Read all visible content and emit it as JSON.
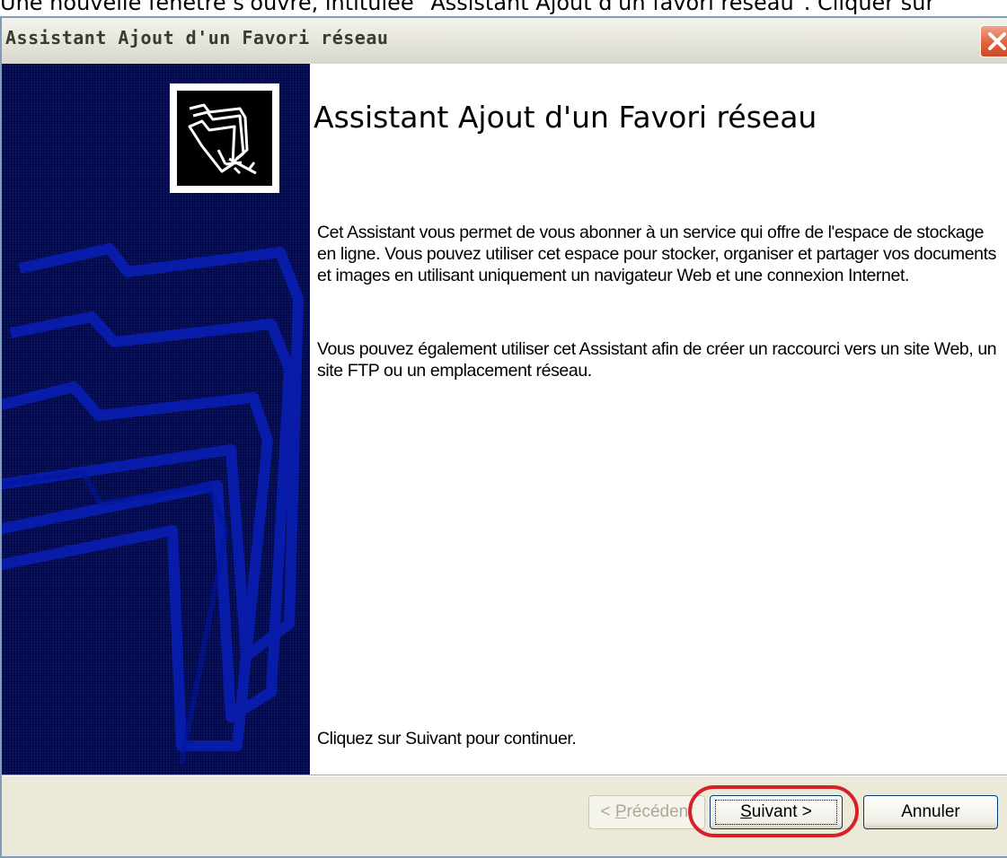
{
  "caption": "Une nouvelle fenêtre s'ouvre, intitulée \"Assistant Ajout d'un favori réseau\". Cliquer sur",
  "window": {
    "title": "Assistant Ajout d'un Favori réseau"
  },
  "content": {
    "heading": "Assistant Ajout d'un Favori réseau",
    "paragraph1": "Cet Assistant vous permet de vous abonner à un service qui offre de l'espace de stockage en ligne. Vous pouvez utiliser cet espace pour stocker, organiser et partager vos documents et images en utilisant uniquement un navigateur Web et une connexion Internet.",
    "paragraph2": "Vous pouvez également utiliser cet Assistant afin de créer un raccourci vers un site Web, un site FTP ou un emplacement réseau.",
    "continue_text": "Cliquez sur Suivant pour continuer."
  },
  "buttons": {
    "back": {
      "prefix": "< ",
      "mnemonic": "P",
      "rest": "récédent"
    },
    "next": {
      "mnemonic": "S",
      "rest": "uivant >"
    },
    "cancel": "Annuler"
  },
  "icons": {
    "close": "close-icon",
    "wizard": "network-folder-icon"
  },
  "colors": {
    "sidebar": "#00084e",
    "highlight": "#d6202a"
  }
}
